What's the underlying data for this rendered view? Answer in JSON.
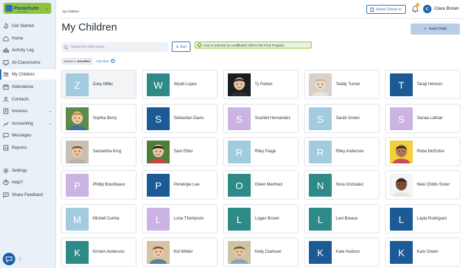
{
  "brand": {
    "name": "Parachute",
    "sub": "by ProCare"
  },
  "nav": [
    {
      "label": "Get Started",
      "icon": "rocket-icon"
    },
    {
      "label": "Home",
      "icon": "home-icon"
    },
    {
      "label": "Activity Log",
      "icon": "activity-icon"
    },
    {
      "label": "All Classrooms",
      "icon": "classroom-icon"
    },
    {
      "label": "My Children",
      "icon": "children-icon",
      "active": true
    },
    {
      "label": "Attendance",
      "icon": "calendar-icon"
    },
    {
      "label": "Contacts",
      "icon": "contacts-icon"
    },
    {
      "label": "Invoices",
      "icon": "invoice-icon",
      "chevron": true
    },
    {
      "label": "Accounting",
      "icon": "accounting-icon",
      "chevron": true
    },
    {
      "label": "Messages",
      "icon": "messages-icon"
    },
    {
      "label": "Reports",
      "icon": "reports-icon"
    },
    {
      "label": "Settings",
      "icon": "gear-icon"
    },
    {
      "label": "Help?",
      "icon": "help-icon"
    },
    {
      "label": "Share Feedback",
      "icon": "feedback-icon"
    }
  ],
  "header": {
    "breadcrumb": "My Children",
    "kiosk_label": "Kiosk Check In",
    "notification_count": "1",
    "user_initial": "C",
    "user_name": "Clara Brown"
  },
  "page": {
    "title": "My Children",
    "add_label": "Add Child",
    "search_placeholder": "Search by child name...",
    "sort_label": "Sort",
    "info_text": "How to onboard an unaffiliated child to the Food Program.",
    "filter_prefix": "Status is",
    "filter_value": "Enrolled",
    "add_filter_label": "Add Filter"
  },
  "colors": {
    "primary": "#2d6fb4",
    "accent_green": "#8fc33f",
    "tile_light_blue": "#a3cbe0",
    "tile_teal": "#2e8a86",
    "tile_navy": "#1c5a96",
    "tile_lavender": "#cbb3e3"
  },
  "children": [
    {
      "name": "Zoey Miller",
      "initial": "Z",
      "tile": "light-blue",
      "selected": true
    },
    {
      "name": "Wyatt Lopez",
      "initial": "W",
      "tile": "teal"
    },
    {
      "name": "Ty Parker",
      "tile": "photo",
      "photo": "boy-portrait-dark"
    },
    {
      "name": "Teddy Turner",
      "tile": "photo",
      "photo": "baby-portrait"
    },
    {
      "name": "Taraji Henson",
      "initial": "T",
      "tile": "navy"
    },
    {
      "name": "Sophia Berry",
      "tile": "photo",
      "photo": "toddler-outdoor"
    },
    {
      "name": "Sebastian Davis",
      "initial": "S",
      "tile": "navy"
    },
    {
      "name": "Scarlett Hernandez",
      "initial": "S",
      "tile": "lavender"
    },
    {
      "name": "Sarah Green",
      "initial": "S",
      "tile": "light-blue"
    },
    {
      "name": "Sanaa Lathan",
      "initial": "S",
      "tile": "lavender"
    },
    {
      "name": "Samantha King",
      "tile": "photo",
      "photo": "girl-curly-hair"
    },
    {
      "name": "Sam Elliot",
      "tile": "photo",
      "photo": "boy-playground"
    },
    {
      "name": "Riley Paige",
      "initial": "R",
      "tile": "light-blue"
    },
    {
      "name": "Riley Anderson",
      "initial": "R",
      "tile": "light-blue"
    },
    {
      "name": "Reba McEntire",
      "tile": "photo",
      "photo": "girl-yellow-bg"
    },
    {
      "name": "Phillip Boudreaux",
      "initial": "P",
      "tile": "lavender"
    },
    {
      "name": "Penelope Lee",
      "initial": "P",
      "tile": "navy"
    },
    {
      "name": "Owen Martinez",
      "initial": "O",
      "tile": "teal"
    },
    {
      "name": "Nora Gonzalez",
      "initial": "N",
      "tile": "teal"
    },
    {
      "name": "New Childs Sister",
      "tile": "photo",
      "photo": "toddler-white-bg"
    },
    {
      "name": "Mishell Cunha",
      "initial": "M",
      "tile": "light-blue"
    },
    {
      "name": "Luna Thompson",
      "initial": "L",
      "tile": "lavender"
    },
    {
      "name": "Logan Brown",
      "initial": "L",
      "tile": "teal"
    },
    {
      "name": "Levi Breaux",
      "initial": "L",
      "tile": "teal"
    },
    {
      "name": "Layla Rodriguez",
      "initial": "L",
      "tile": "navy"
    },
    {
      "name": "Kirsten Anderson",
      "initial": "K",
      "tile": "teal"
    },
    {
      "name": "Kid Wittler",
      "tile": "photo",
      "photo": "boy-smiling"
    },
    {
      "name": "Kelly Clarkson",
      "tile": "photo",
      "photo": "kid-outdoor-hat"
    },
    {
      "name": "Kate Hudson",
      "initial": "K",
      "tile": "navy"
    },
    {
      "name": "Kam Green",
      "initial": "K",
      "tile": "navy"
    }
  ]
}
